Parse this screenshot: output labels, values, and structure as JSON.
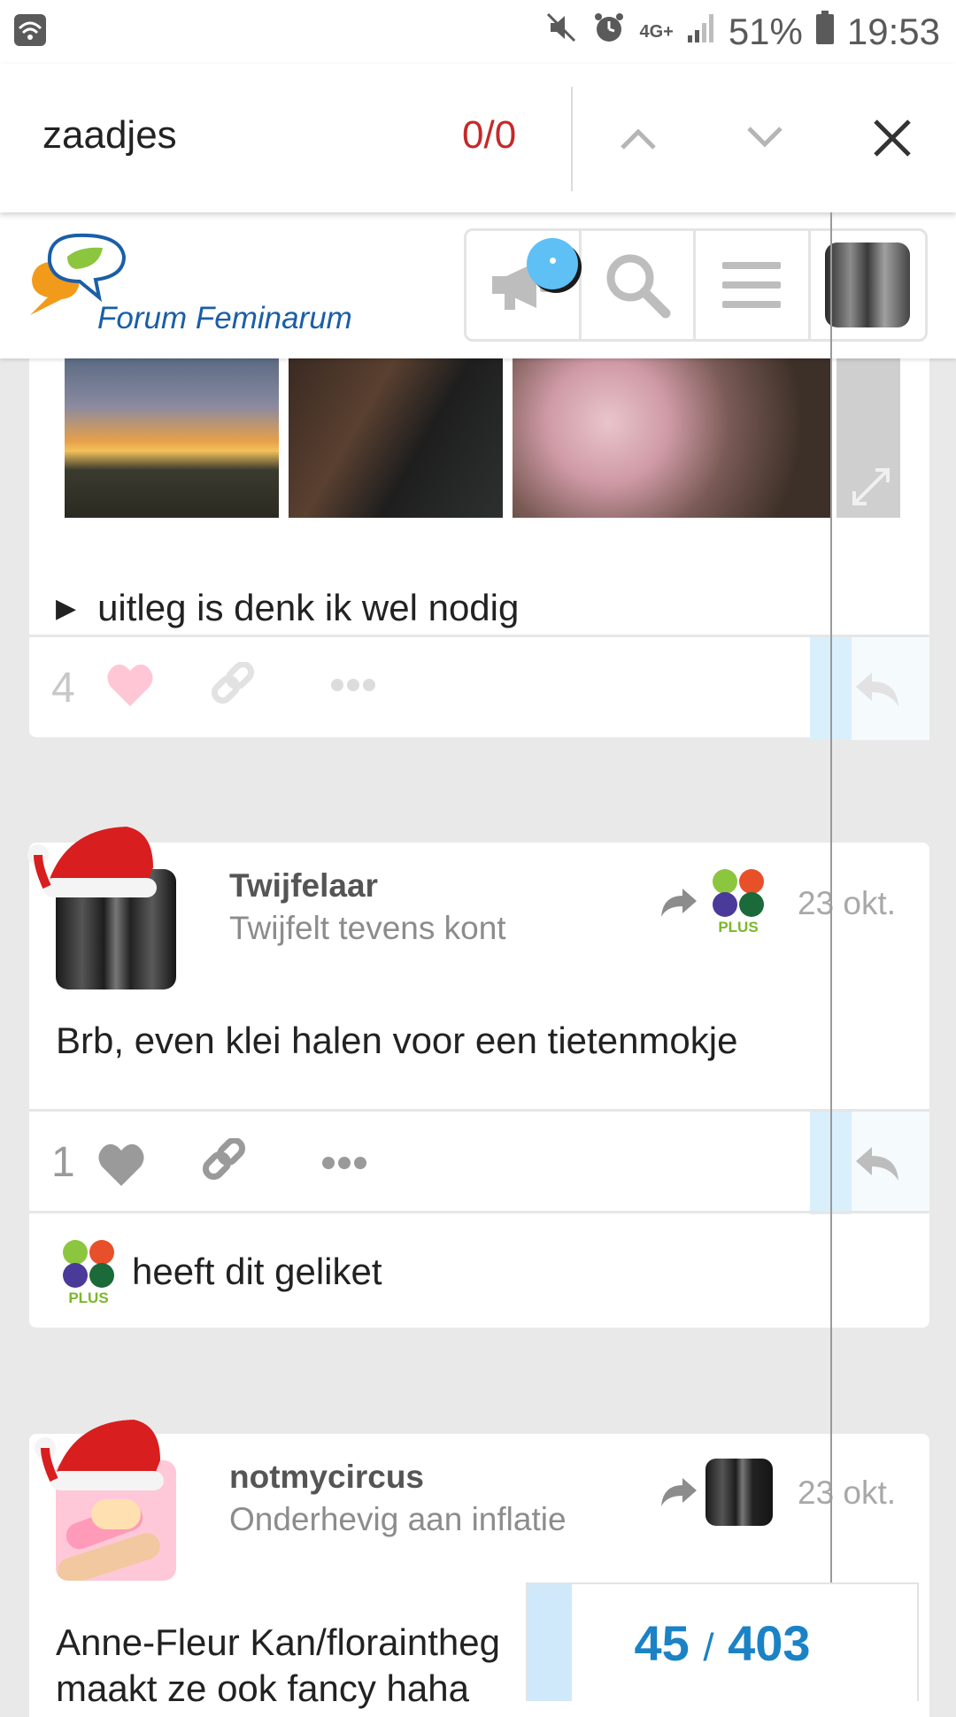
{
  "status_bar": {
    "network": "4G+",
    "battery": "51%",
    "time": "19:53"
  },
  "find_bar": {
    "query": "zaadjes",
    "count": "0/0"
  },
  "forum": {
    "name": "Forum Feminarum"
  },
  "post1": {
    "details_summary": "uitleg is denk ik wel nodig",
    "likes": "4"
  },
  "post2": {
    "username": "Twijfelaar",
    "user_title": "Twijfelt tevens kont",
    "date": "23 okt.",
    "reply_to_badge": "PLUS",
    "body": "Brb, even klei halen voor een tietenmokje",
    "likes": "1",
    "liked_by_badge": "PLUS",
    "liked_text": "heeft dit geliket"
  },
  "post3": {
    "username": "notmycircus",
    "user_title": "Onderhevig aan inflatie",
    "date": "23 okt.",
    "body_line1": "Anne-Fleur Kan/floraintheg",
    "body_line2": "maakt ze ook fancy haha"
  },
  "progress": {
    "current": "45",
    "separator": "/",
    "total": "403"
  },
  "colors": {
    "accent": "#1b82c5",
    "find_count": "#c62828",
    "liked": "#ffc7d5"
  }
}
